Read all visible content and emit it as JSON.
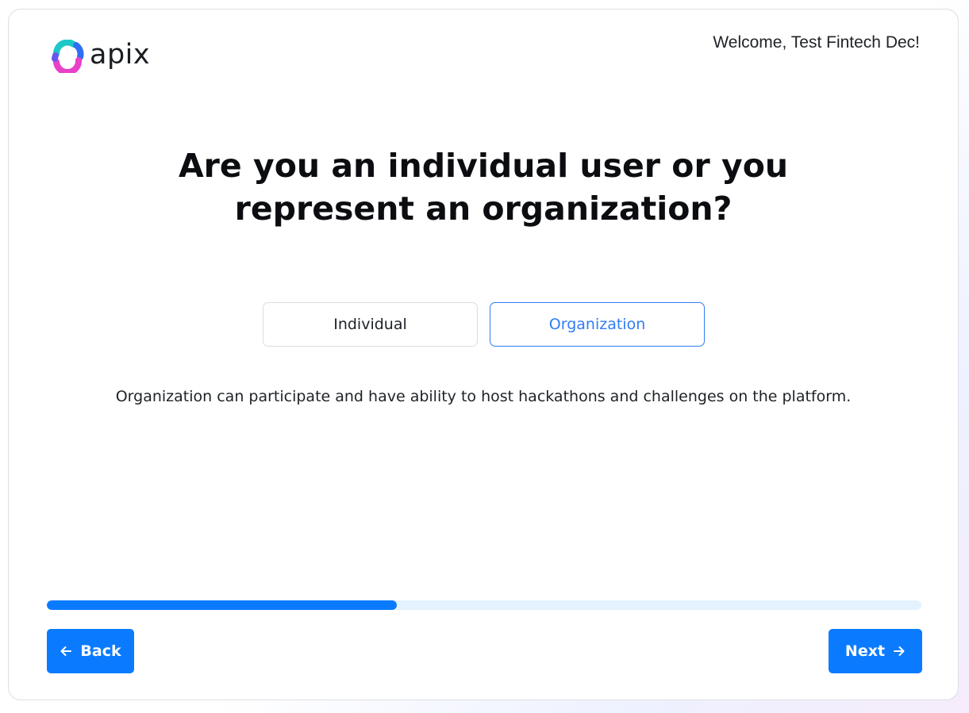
{
  "header": {
    "logo_text": "apix",
    "welcome_text": "Welcome, Test Fintech Dec!"
  },
  "main": {
    "question": "Are you an individual user or you represent an organization?",
    "options": [
      {
        "label": "Individual",
        "selected": false
      },
      {
        "label": "Organization",
        "selected": true
      }
    ],
    "description": "Organization can participate and have ability to host hackathons and challenges on the platform."
  },
  "progress": {
    "fraction": 0.4
  },
  "footer": {
    "back_label": "Back",
    "next_label": "Next"
  },
  "icons": {
    "logo": "apix-logo-icon",
    "back": "arrow-left-icon",
    "next": "arrow-right-icon"
  },
  "colors": {
    "primary": "#0a7bff",
    "selected_option": "#2f7cf6",
    "progress_track": "#e4f1ff",
    "logo_teal": "#1ec8c8",
    "logo_blue": "#2f6ff5",
    "logo_magenta": "#e840c8"
  }
}
